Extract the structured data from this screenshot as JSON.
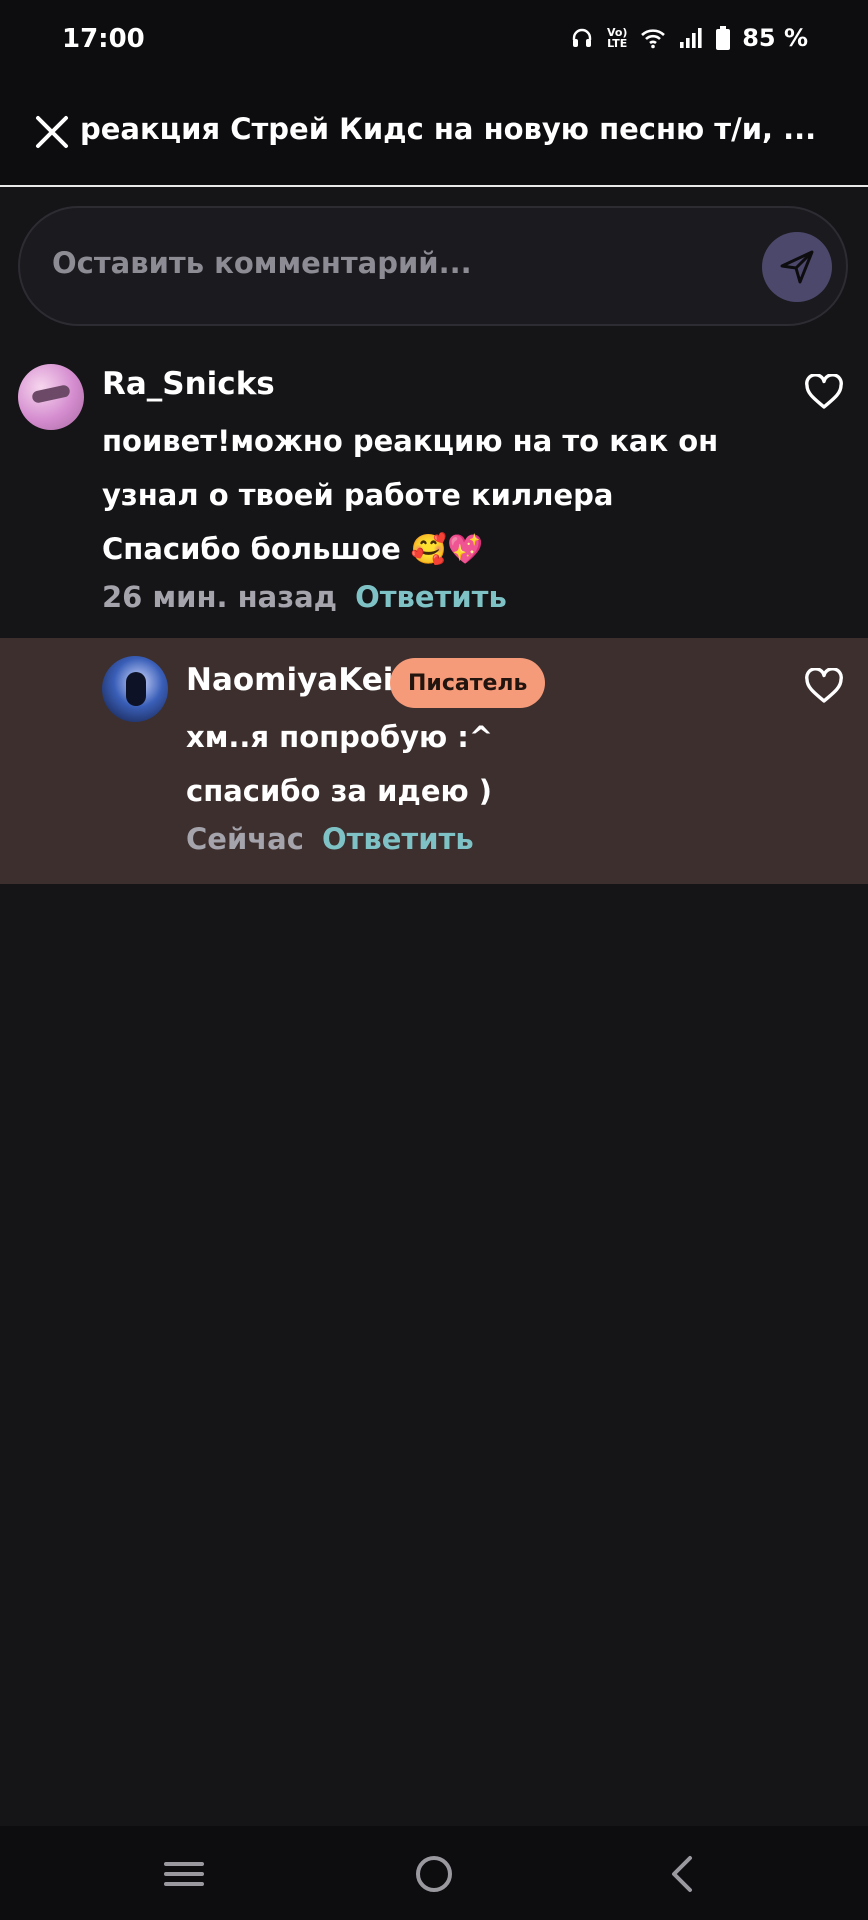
{
  "status_bar": {
    "time": "17:00",
    "volte": "Vo) LTE",
    "battery": "85 %"
  },
  "header": {
    "title": "реакция Стрей Кидс на новую песню т/и, ..."
  },
  "composer": {
    "placeholder": "Оставить комментарий..."
  },
  "comments": [
    {
      "user": "Ra_Snicks",
      "lines": [
        "поивет!можно реакцию на то как он",
        "узнал о твоей работе киллера",
        "Спасибо большое 🥰💖"
      ],
      "time": "26 мин. назад",
      "reply_label": "Ответить"
    },
    {
      "user": "NaomiyaKei",
      "badge": "Писатель",
      "lines": [
        "хм..я попробую :^",
        "спасибо за идею )"
      ],
      "time": "Сейчас",
      "reply_label": "Ответить"
    }
  ],
  "colors": {
    "background": "#151417",
    "reply_bg": "#3c2f2e",
    "badge": "#f69b79",
    "reply_link": "#7fc2c6"
  }
}
